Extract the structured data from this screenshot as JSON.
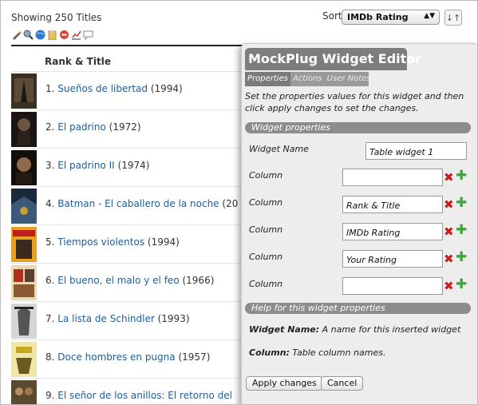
{
  "list": {
    "showing": "Showing 250 Titles",
    "sort_label": "Sort by:",
    "sort_value": "IMDb Rating",
    "sort_dir_icon": "sort-direction-icon",
    "column_header": "Rank & Title",
    "toolbar_icons": [
      "pencil-icon",
      "zoom-icon",
      "globe-icon",
      "clipboard-icon",
      "stop-icon",
      "chart-icon",
      "comment-icon"
    ],
    "rows": [
      {
        "rank": "1.",
        "title": "Sueños de libertad",
        "year": "(1994)"
      },
      {
        "rank": "2.",
        "title": "El padrino",
        "year": "(1972)"
      },
      {
        "rank": "3.",
        "title": "El padrino II",
        "year": "(1974)"
      },
      {
        "rank": "4.",
        "title": "Batman - El caballero de la noche",
        "year": "(20"
      },
      {
        "rank": "5.",
        "title": "Tiempos violentos",
        "year": "(1994)"
      },
      {
        "rank": "6.",
        "title": "El bueno, el malo y el feo",
        "year": "(1966)"
      },
      {
        "rank": "7.",
        "title": "La lista de Schindler",
        "year": "(1993)"
      },
      {
        "rank": "8.",
        "title": "Doce hombres en pugna",
        "year": "(1957)"
      },
      {
        "rank": "9.",
        "title": "El señor de los anillos: El retorno del",
        "year": ""
      }
    ]
  },
  "editor": {
    "title": "MockPlug Widget Editor",
    "tabs": [
      "Properties",
      "Actions",
      "User Notes"
    ],
    "intro": "Set the properties values for this widget and then click apply changes to set the changes.",
    "section_properties": "Widget properties",
    "widget_name_label": "Widget Name",
    "widget_name_value": "Table widget 1",
    "column_label": "Column",
    "columns": [
      "",
      "Rank & Title",
      "IMDb Rating",
      "Your Rating",
      ""
    ],
    "section_help": "Help for this widget properties",
    "help": [
      {
        "term": "Widget Name:",
        "text": " A name for this inserted widget"
      },
      {
        "term": "Column:",
        "text": " Table column names."
      }
    ],
    "apply_label": "Apply changes",
    "cancel_label": "Cancel"
  },
  "colors": {
    "link": "#1f5e9a",
    "delete": "#cc1d1d",
    "add": "#3aa83a",
    "panel_header": "#7d7d7d"
  }
}
